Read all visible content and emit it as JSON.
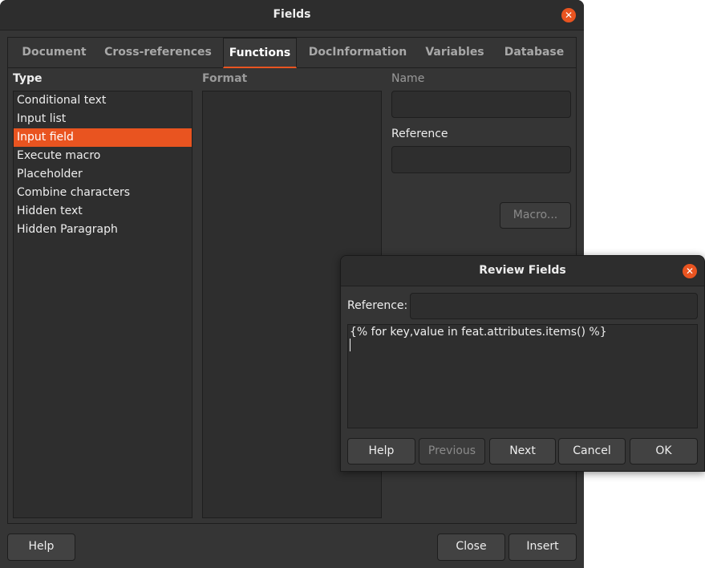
{
  "fields_dialog": {
    "title": "Fields",
    "close_glyph": "✕",
    "tabs": [
      {
        "label": "Document"
      },
      {
        "label": "Cross-references"
      },
      {
        "label": "Functions"
      },
      {
        "label": "DocInformation"
      },
      {
        "label": "Variables"
      },
      {
        "label": "Database"
      }
    ],
    "active_tab": "Functions",
    "type_label": "Type",
    "format_label": "Format",
    "name_label": "Name",
    "reference_label": "Reference",
    "type_items": [
      {
        "label": "Conditional text"
      },
      {
        "label": "Input list"
      },
      {
        "label": "Input field"
      },
      {
        "label": "Execute macro"
      },
      {
        "label": "Placeholder"
      },
      {
        "label": "Combine characters"
      },
      {
        "label": "Hidden text"
      },
      {
        "label": "Hidden Paragraph"
      }
    ],
    "selected_type": "Input field",
    "name_value": "",
    "reference_value": "",
    "macro_button": "Macro...",
    "help_button": "Help",
    "close_button": "Close",
    "insert_button": "Insert"
  },
  "review_dialog": {
    "title": "Review Fields",
    "close_glyph": "✕",
    "reference_label": "Reference:",
    "reference_value": "",
    "text_value": "{% for key,value in feat.attributes.items() %}",
    "help_button": "Help",
    "previous_button": "Previous",
    "next_button": "Next",
    "cancel_button": "Cancel",
    "ok_button": "OK"
  },
  "colors": {
    "accent": "#e95420",
    "background": "#353535",
    "field": "#2e2e2e"
  }
}
